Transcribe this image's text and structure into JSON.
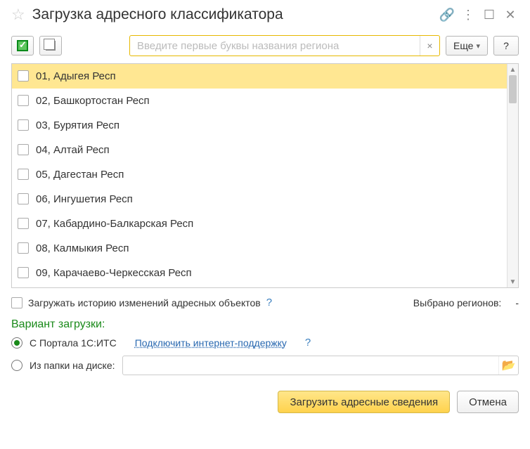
{
  "header": {
    "title": "Загрузка адресного классификатора"
  },
  "toolbar": {
    "search_placeholder": "Введите первые буквы названия региона",
    "more_label": "Еще",
    "help_label": "?"
  },
  "regions": [
    {
      "label": "01, Адыгея Респ",
      "selected": true
    },
    {
      "label": "02, Башкортостан Респ",
      "selected": false
    },
    {
      "label": "03, Бурятия Респ",
      "selected": false
    },
    {
      "label": "04, Алтай Респ",
      "selected": false
    },
    {
      "label": "05, Дагестан Респ",
      "selected": false
    },
    {
      "label": "06, Ингушетия Респ",
      "selected": false
    },
    {
      "label": "07, Кабардино-Балкарская Респ",
      "selected": false
    },
    {
      "label": "08, Калмыкия Респ",
      "selected": false
    },
    {
      "label": "09, Карачаево-Черкесская Респ",
      "selected": false
    }
  ],
  "options": {
    "history_label": "Загружать историю изменений адресных объектов",
    "selected_regions_label": "Выбрано регионов:",
    "selected_regions_count": "-"
  },
  "variant": {
    "title": "Вариант загрузки:",
    "portal_label": "С Портала 1С:ИТС",
    "connect_link": "Подключить интернет-поддержку",
    "folder_label": "Из папки на диске:"
  },
  "footer": {
    "load_label": "Загрузить адресные сведения",
    "cancel_label": "Отмена"
  },
  "icons": {
    "clear": "×",
    "dropdown": "▾",
    "help": "?",
    "link": "🔗",
    "menu": "⋮",
    "maximize": "☐",
    "close": "✕",
    "up": "▲",
    "down": "▼",
    "folder": "📂",
    "star": "☆"
  }
}
